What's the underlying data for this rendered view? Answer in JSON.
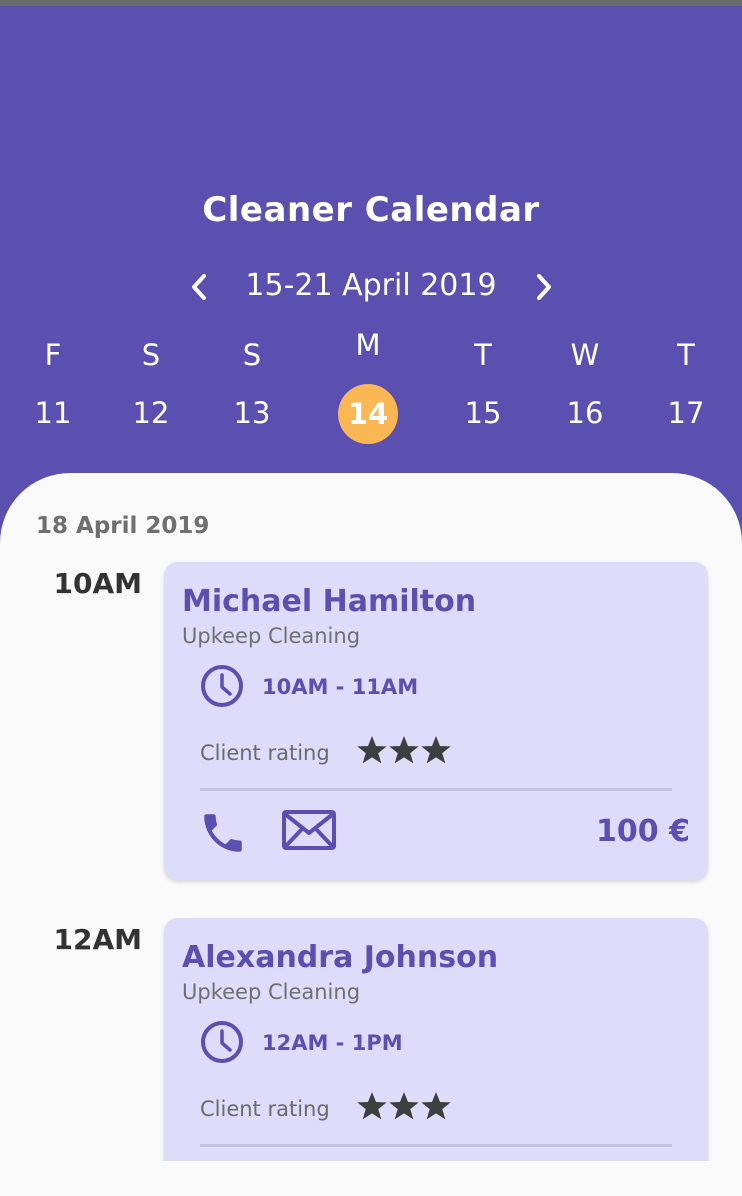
{
  "header": {
    "title": "Cleaner Calendar",
    "week_range": "15-21 April 2019",
    "prev_icon": "chevron-left-icon",
    "next_icon": "chevron-right-icon"
  },
  "days": [
    {
      "letter": "F",
      "number": "11",
      "selected": false
    },
    {
      "letter": "S",
      "number": "12",
      "selected": false
    },
    {
      "letter": "S",
      "number": "13",
      "selected": false
    },
    {
      "letter": "M",
      "number": "14",
      "selected": true
    },
    {
      "letter": "T",
      "number": "15",
      "selected": false
    },
    {
      "letter": "W",
      "number": "16",
      "selected": false
    },
    {
      "letter": "T",
      "number": "17",
      "selected": false
    }
  ],
  "schedule": {
    "date": "18 April 2019",
    "appointments": [
      {
        "time": "10AM",
        "client": "Michael Hamilton",
        "service": "Upkeep Cleaning",
        "time_range": "10AM - 11AM",
        "rating_label": "Client rating",
        "rating": 3,
        "price": "100 €"
      },
      {
        "time": "12AM",
        "client": "Alexandra Johnson",
        "service": "Upkeep Cleaning",
        "time_range": "12AM - 1PM",
        "rating_label": "Client rating",
        "rating": 3,
        "price": ""
      }
    ]
  },
  "colors": {
    "primary": "#5b4fb0",
    "accent": "#fbb754",
    "card": "#dedbfb",
    "background": "#fafafa"
  }
}
